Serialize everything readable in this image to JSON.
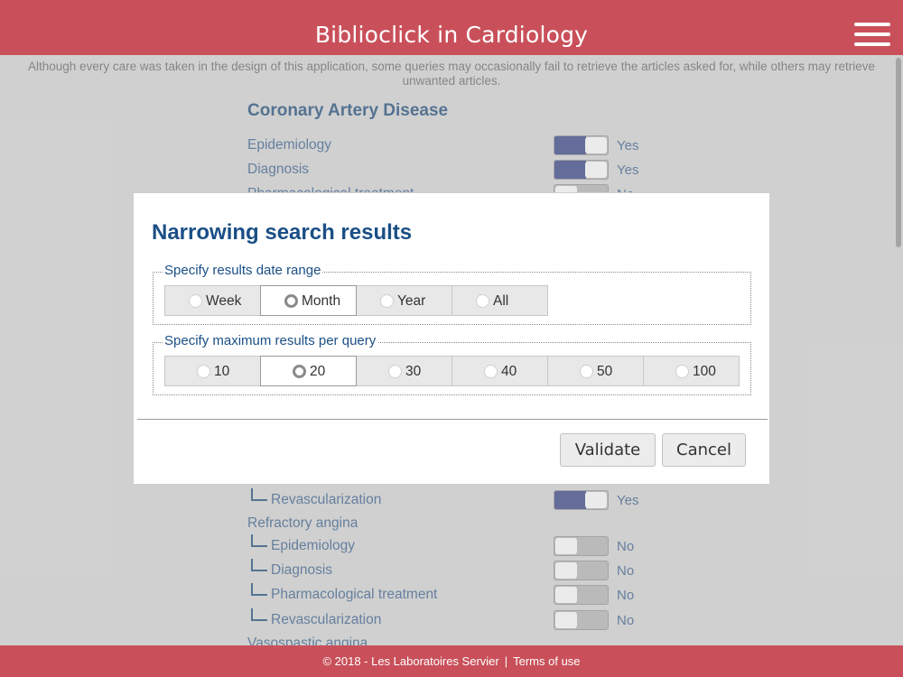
{
  "header": {
    "title": "Biblioclick in Cardiology",
    "menu_icon": "hamburger-menu-icon"
  },
  "disclaimer": "Although every care was taken in the design of this application, some queries may occasionally fail to retrieve the articles asked for, while others may retrieve unwanted articles.",
  "section": {
    "title": "Coronary Artery Disease"
  },
  "rows": [
    {
      "label": "Epidemiology",
      "state": "Yes",
      "on": true,
      "sub": false
    },
    {
      "label": "Diagnosis",
      "state": "Yes",
      "on": true,
      "sub": false
    },
    {
      "label": "Pharmacological treatment",
      "state": "No",
      "on": false,
      "sub": false
    },
    {
      "label": "Revascularization",
      "state": "Yes",
      "on": true,
      "sub": true
    },
    {
      "label": "Refractory angina",
      "state": "",
      "on": null,
      "sub": false
    },
    {
      "label": "Epidemiology",
      "state": "No",
      "on": false,
      "sub": true
    },
    {
      "label": "Diagnosis",
      "state": "No",
      "on": false,
      "sub": true
    },
    {
      "label": "Pharmacological treatment",
      "state": "No",
      "on": false,
      "sub": true
    },
    {
      "label": "Revascularization",
      "state": "No",
      "on": false,
      "sub": true
    },
    {
      "label": "Vasospastic angina",
      "state": "",
      "on": null,
      "sub": false
    }
  ],
  "modal": {
    "title": "Narrowing search results",
    "date_range": {
      "legend": "Specify results date range",
      "options": [
        "Week",
        "Month",
        "Year",
        "All"
      ],
      "selected": "Month"
    },
    "max_results": {
      "legend": "Specify maximum results per query",
      "options": [
        "10",
        "20",
        "30",
        "40",
        "50",
        "100"
      ],
      "selected": "20"
    },
    "validate_label": "Validate",
    "cancel_label": "Cancel"
  },
  "footer": {
    "copyright": "© 2018 - Les Laboratoires Servier",
    "separator": "|",
    "terms": "Terms of use"
  },
  "colors": {
    "brand": "#c9505a",
    "title_blue": "#1a4f86",
    "toggle_on": "#3e4a8b"
  }
}
